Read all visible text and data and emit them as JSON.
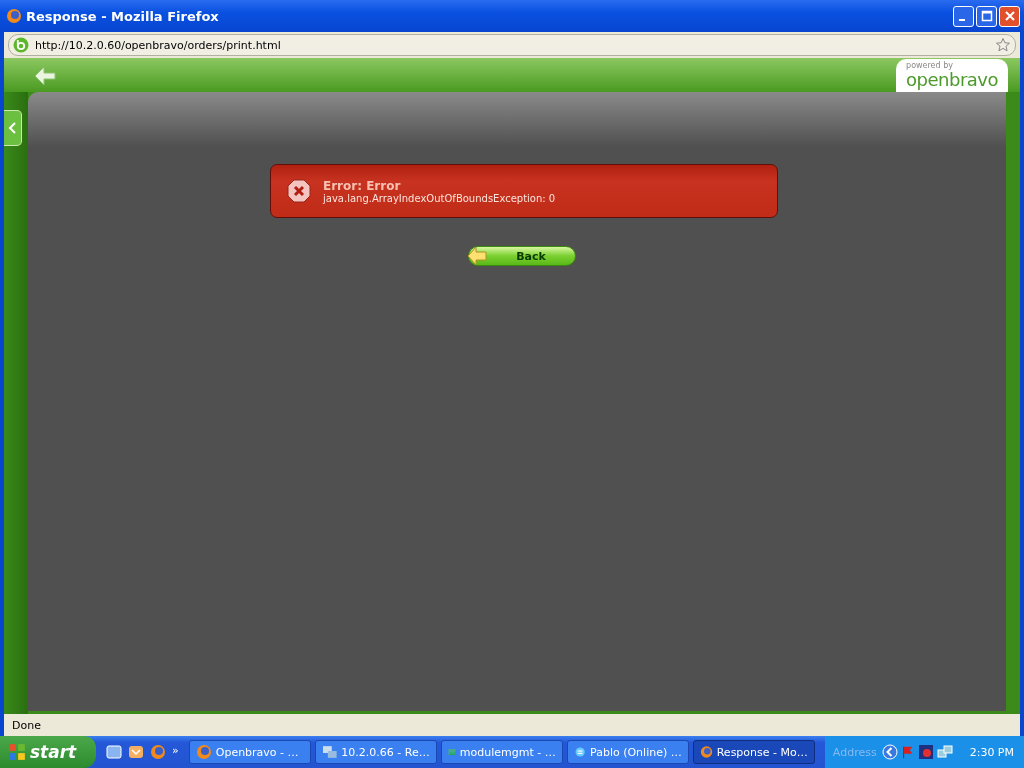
{
  "window": {
    "title": "Response - Mozilla Firefox"
  },
  "address_bar": {
    "url": "http://10.2.0.60/openbravo/orders/print.html"
  },
  "logo": {
    "caption": "powered by",
    "name": "openbravo"
  },
  "error": {
    "title": "Error: Error",
    "message": "java.lang.ArrayIndexOutOfBoundsException: 0"
  },
  "back_button": {
    "label": "Back"
  },
  "status_bar": {
    "text": "Done"
  },
  "taskbar": {
    "start": "start",
    "quick_launch_more": "»",
    "items": [
      {
        "label": "Openbravo - …",
        "kind": "firefox",
        "selected": false
      },
      {
        "label": "10.2.0.66 - Re…",
        "kind": "remote",
        "selected": false
      },
      {
        "label": "modulemgmt - …",
        "kind": "image",
        "selected": false
      },
      {
        "label": "Pablo (Online) …",
        "kind": "chat",
        "selected": false
      },
      {
        "label": "Response - Mo…",
        "kind": "firefox",
        "selected": true
      }
    ],
    "address_label": "Address",
    "clock": "2:30 PM"
  }
}
